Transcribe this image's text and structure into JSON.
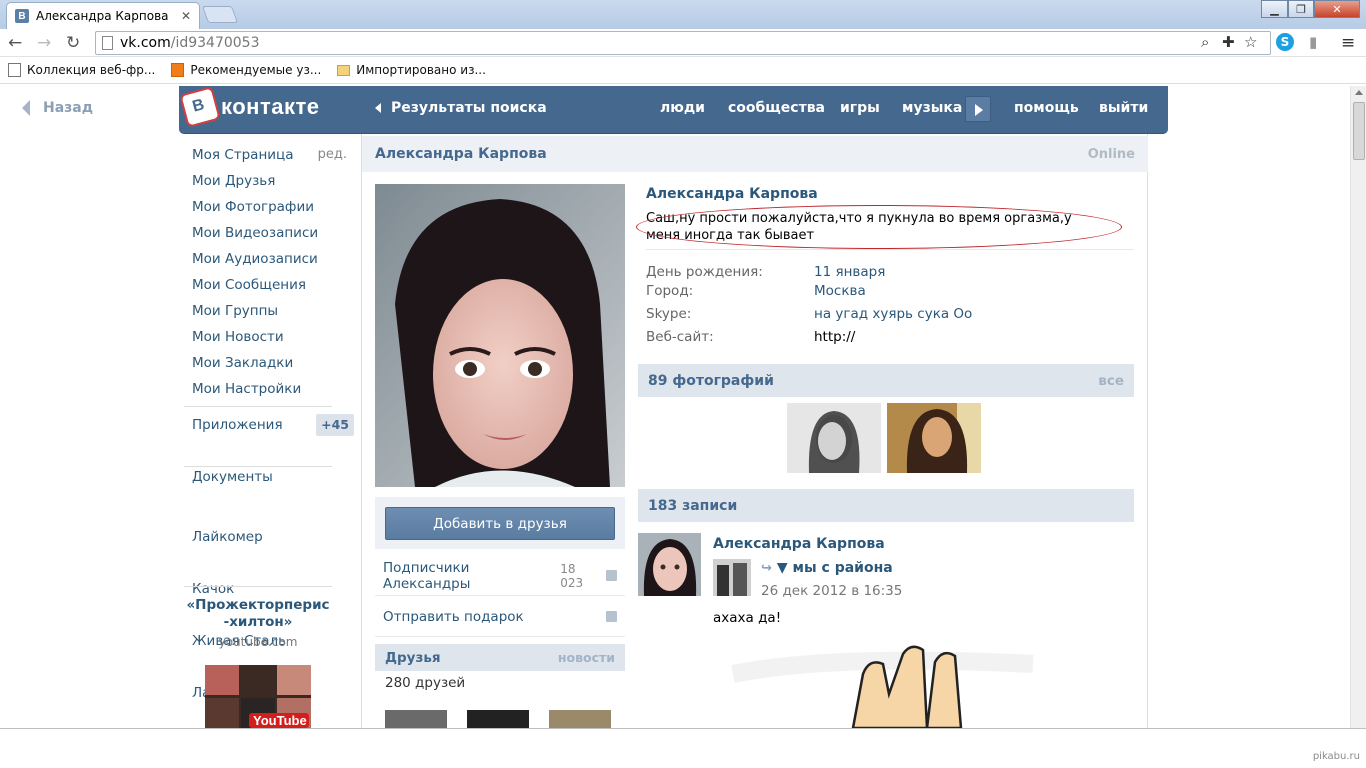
{
  "browser": {
    "tab_title": "Александра Карпова",
    "tab_favicon": "В",
    "tab_close": "✕",
    "url_domain": "vk.com",
    "url_path": "/id93470053",
    "bookmarks": [
      {
        "label": "Коллекция веб-фр...",
        "icon": "page-icon"
      },
      {
        "label": "Рекомендуемые уз...",
        "icon": "orange-bookmark-icon"
      },
      {
        "label": "Импортировано из...",
        "icon": "folder-icon"
      }
    ]
  },
  "page": {
    "back_label": "Назад",
    "header": {
      "logo_letter": "В",
      "logo_word": "контакте",
      "search_results": "Результаты поиска",
      "nav": [
        "люди",
        "сообщества",
        "игры",
        "музыка",
        "помощь",
        "выйти"
      ]
    },
    "left_menu": {
      "items": [
        "Моя Страница",
        "Мои Друзья",
        "Мои Фотографии",
        "Мои Видеозаписи",
        "Мои Аудиозаписи",
        "Мои Сообщения",
        "Мои Группы",
        "Мои Новости",
        "Мои Закладки",
        "Мои Настройки"
      ],
      "edit_label": "ред.",
      "apps_label": "Приложения",
      "apps_badge": "+45",
      "docs_label": "Документы",
      "apps_list": [
        "Лайкомер",
        "Качок",
        "Живая Сталь",
        "Лайкер"
      ],
      "promo_title": "«Прожекторперис -хилтон»",
      "promo_site": "youtube.com",
      "promo_brand": "YouTube"
    },
    "profile": {
      "header_name": "Александра Карпова",
      "online": "Online",
      "name": "Александра Карпова",
      "status": "Саш,ну прости пожалуйста,что я пукнула во время оргазма,у меня иногда так бывает",
      "info": [
        {
          "key": "День рождения:",
          "value": "11 января"
        },
        {
          "key": "Город:",
          "value": "Москва"
        },
        {
          "key": "Skype:",
          "value": "на угад хуярь сука Оо"
        },
        {
          "key": "Веб-сайт:",
          "value": "http://"
        }
      ],
      "add_friend": "Добавить в друзья",
      "subscribers_label": "Подписчики Александры",
      "subscribers_count": "18 023",
      "gift_label": "Отправить подарок",
      "friends_title": "Друзья",
      "friends_news": "новости",
      "friends_count": "280 друзей",
      "photos_title": "89 фотографий",
      "photos_all": "все",
      "posts_title": "183 записи",
      "post": {
        "author": "Александра Карпова",
        "shared_from": "▼ мы с района",
        "date": "26 дек 2012 в 16:35",
        "text": "ахаха да!"
      }
    }
  },
  "watermark": "pikabu.ru",
  "colors": {
    "vk_blue": "#45688e",
    "link": "#2b587a",
    "highlight_ring": "#c0262c"
  }
}
